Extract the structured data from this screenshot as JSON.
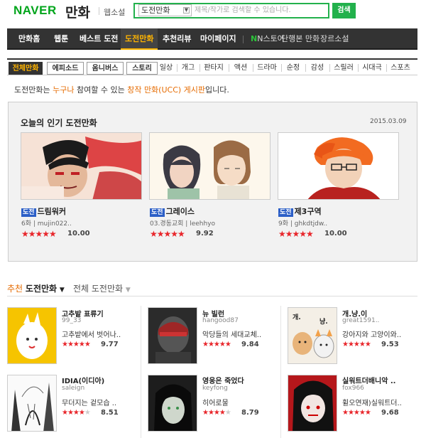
{
  "header": {
    "logo": "NAVER",
    "service": "만화",
    "webnovel": "웹소설",
    "search_scope": "도전만화",
    "search_placeholder": "제목/작가로 검색할 수 있습니다.",
    "search_button": "검색"
  },
  "nav": {
    "items": [
      "만화홈",
      "웹툰",
      "베스트 도전",
      "도전만화",
      "추천리뷰",
      "마이페이지"
    ],
    "store": "N스토어",
    "extra": [
      "단행본 만화",
      "장르소설"
    ]
  },
  "genres": {
    "main": [
      "전체만화",
      "에피소드",
      "옴니버스",
      "스토리"
    ],
    "sub": [
      "일상",
      "개그",
      "판타지",
      "액션",
      "드라마",
      "순정",
      "감성",
      "스릴러",
      "시대극",
      "스포츠"
    ]
  },
  "intro": {
    "prefix": "도전만화는 ",
    "anyone": "누구나",
    "middle": " 참여할 수 있는 ",
    "board": "창작 만화(UCC) 게시판",
    "suffix": "입니다."
  },
  "today": {
    "title": "오늘의 인기 도전만화",
    "date": "2015.03.09",
    "tag": "도전",
    "items": [
      {
        "title": "드림워커",
        "episode": "6화",
        "author": "mujin022..",
        "rating": "10.00",
        "stars": 5
      },
      {
        "title": "그레이스",
        "episode": "03.경동교회",
        "author": "leehhyo",
        "rating": "9.92",
        "stars": 5
      },
      {
        "title": "제3구역",
        "episode": "9화",
        "author": "ghkdtjdw..",
        "rating": "10.00",
        "stars": 5
      }
    ]
  },
  "recommend": {
    "label_red": "추천",
    "label_bold": "도전만화",
    "all": "전체 도전만화",
    "items": [
      {
        "title": "고추밭 표류기",
        "author": "99_33",
        "desc": "고추밭에서 벗어나..",
        "rating": "9.77",
        "stars": 5
      },
      {
        "title": "뉴 빌런",
        "author": "hangood87",
        "desc": "악당들의 세대교체..",
        "rating": "9.84",
        "stars": 5
      },
      {
        "title": "개.냥.이",
        "author": "great1591..",
        "desc": "강아지와 고양이와..",
        "rating": "9.53",
        "stars": 5
      },
      {
        "title": "IDIA(이디아)",
        "author": "saleign",
        "desc": "무더지는 겉모습 ..",
        "rating": "8.51",
        "stars": 4
      },
      {
        "title": "영웅은 죽었다",
        "author": "keyfong",
        "desc": "히어로물",
        "rating": "8.79",
        "stars": 4
      },
      {
        "title": "실워트더배니악 ..",
        "author": "fox966",
        "desc": "휠오연재)실워트더..",
        "rating": "9.68",
        "stars": 5
      }
    ]
  },
  "colors": {
    "naver_green": "#00a51b",
    "search_green": "#22b14c",
    "nav_bg": "#333333",
    "active_yellow": "#ffb400",
    "star_red": "#e8262b",
    "tag_blue": "#2c5fc7"
  }
}
